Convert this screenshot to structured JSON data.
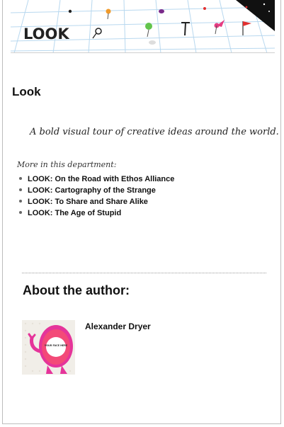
{
  "banner": {
    "label": "LOOK",
    "colors": {
      "grid": "#b8d8ef",
      "ink": "#222222",
      "pin_orange": "#f09a2b",
      "pin_green": "#62c44c",
      "pin_pink": "#e63c82",
      "flag_red": "#e23030",
      "corner": "#111111"
    }
  },
  "section": {
    "title": "Look"
  },
  "tagline": "A bold visual tour of creative ideas around the world.",
  "more": {
    "label": "More in this department:",
    "items": [
      {
        "label": "LOOK: On the Road with Ethos Alliance"
      },
      {
        "label": "LOOK: Cartography of the Strange"
      },
      {
        "label": "LOOK: To Share and Share Alike"
      },
      {
        "label": "LOOK: The Age of Stupid"
      }
    ]
  },
  "about": {
    "heading": "About the author:",
    "author_name": "Alexander Dryer",
    "avatar_text": "YOUR FACE HERE",
    "colors": {
      "avatar_bg": "#f1eee8",
      "monster": "#e5349a",
      "monster_inner": "#ff5c5c"
    }
  }
}
